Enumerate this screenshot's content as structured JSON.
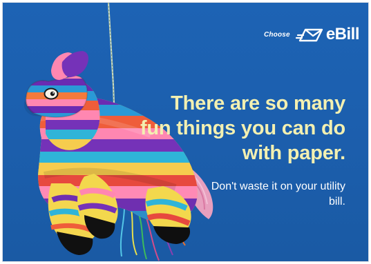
{
  "brand": {
    "choose_label": "Choose",
    "product_label": "eBill",
    "icon": "envelope-icon"
  },
  "headline": "There are so many fun things you can do with paper.",
  "subline": "Don't waste it on your utility bill.",
  "visuals": {
    "subject": "pinata-llama",
    "string_icon": "rope-icon"
  },
  "colors": {
    "background": "#1c5fae",
    "headline": "#f3f0b1",
    "subline": "#ffffff",
    "logo": "#ffffff"
  }
}
